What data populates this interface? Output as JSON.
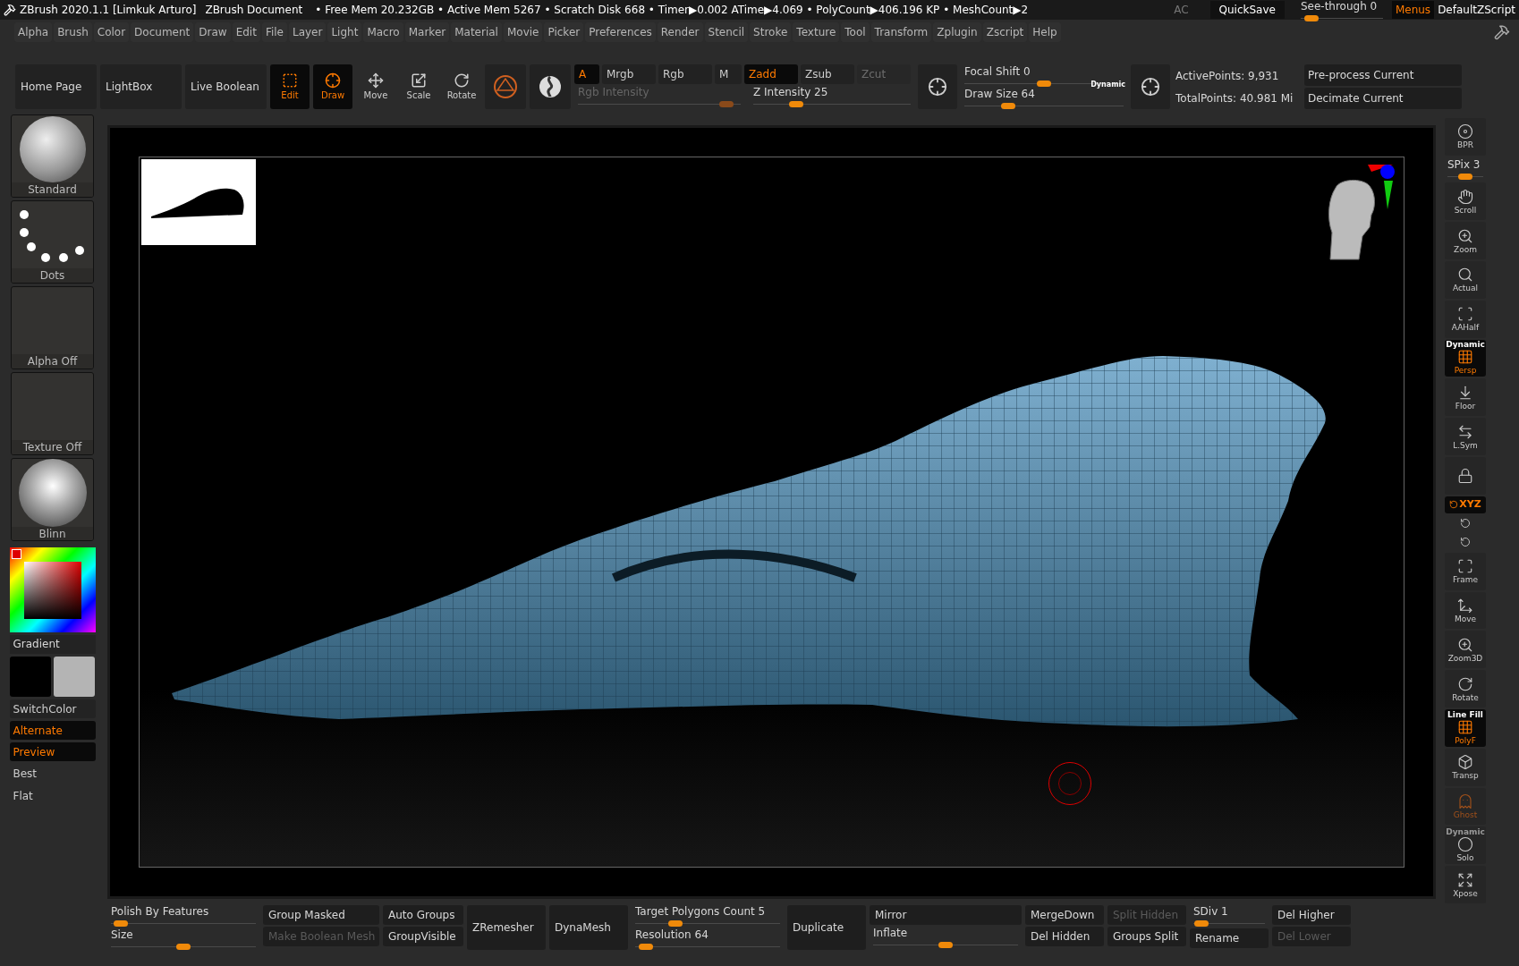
{
  "title_bar": {
    "app_title": "ZBrush 2020.1.1 [Limkuk Arturo]",
    "document": "ZBrush Document",
    "stats": "• Free Mem 20.232GB • Active Mem 5267 • Scratch Disk 668 •  Timer▶0.002 ATime▶4.069 • PolyCount▶406.196 KP  • MeshCount▶2",
    "ac": "AC",
    "quicksave": "QuickSave",
    "see_through": {
      "label": "See-through",
      "value": "0",
      "level": 0.05
    },
    "menus": {
      "label": "Menus",
      "selected": true
    },
    "script": "DefaultZScript"
  },
  "menu": [
    "Alpha",
    "Brush",
    "Color",
    "Document",
    "Draw",
    "Edit",
    "File",
    "Layer",
    "Light",
    "Macro",
    "Marker",
    "Material",
    "Movie",
    "Picker",
    "Preferences",
    "Render",
    "Stencil",
    "Stroke",
    "Texture",
    "Tool",
    "Transform",
    "Zplugin",
    "Zscript",
    "Help"
  ],
  "toolbar": {
    "pages": [
      "Home Page",
      "LightBox",
      "Live Boolean"
    ],
    "modes": [
      {
        "label": "Edit",
        "kind": "edit",
        "active": true
      },
      {
        "label": "Draw",
        "kind": "draw",
        "active": true
      },
      {
        "label": "Move",
        "kind": "move",
        "active": false
      },
      {
        "label": "Scale",
        "kind": "scale",
        "active": false
      },
      {
        "label": "Rotate",
        "kind": "rotate",
        "active": false
      }
    ],
    "channels": [
      {
        "label": "A",
        "active": true,
        "disabled": false
      },
      {
        "label": "Mrgb",
        "active": false,
        "disabled": false
      },
      {
        "label": "Rgb",
        "active": false,
        "disabled": false
      },
      {
        "label": "M",
        "active": false,
        "disabled": false
      },
      {
        "label": "Zadd",
        "active": true,
        "disabled": false
      },
      {
        "label": "Zsub",
        "active": false,
        "disabled": false
      },
      {
        "label": "Zcut",
        "active": false,
        "disabled": true
      }
    ],
    "rgb_intensity": {
      "label": "Rgb Intensity",
      "level": 0.95,
      "disabled": true
    },
    "z_intensity": {
      "label": "Z Intensity",
      "value": "25",
      "level": 0.25,
      "disabled": false
    },
    "focal_shift": {
      "label": "Focal Shift",
      "value": "0",
      "level": 0.5,
      "disabled": false
    },
    "draw_size": {
      "label": "Draw Size",
      "value": "64",
      "level": 0.25,
      "disabled": false
    },
    "dynamic": "Dynamic",
    "active_points": "ActivePoints: 9,931",
    "total_points": "TotalPoints: 40.981 Mi",
    "actions": [
      "Pre-process Current",
      "Decimate Current"
    ]
  },
  "left_shelf": {
    "tiles": [
      {
        "label": "Standard",
        "kind": "brush"
      },
      {
        "label": "Dots",
        "kind": "stroke"
      },
      {
        "label": "Alpha Off",
        "kind": "empty"
      },
      {
        "label": "Texture Off",
        "kind": "empty"
      },
      {
        "label": "Blinn",
        "kind": "material"
      }
    ],
    "gradient": "Gradient",
    "buttons": [
      {
        "label": "SwitchColor",
        "active": false
      },
      {
        "label": "Alternate",
        "active": true
      },
      {
        "label": "Preview",
        "active": true
      }
    ],
    "render_modes": [
      "Best",
      "Flat"
    ]
  },
  "right_shelf": [
    {
      "kind": "bpr",
      "label": "BPR",
      "active": false
    },
    {
      "kind": "spix",
      "label": "SPix",
      "value": "3",
      "level": 0.5
    },
    {
      "kind": "scroll",
      "label": "Scroll",
      "active": false
    },
    {
      "kind": "zoom",
      "label": "Zoom",
      "active": false
    },
    {
      "kind": "actual",
      "label": "Actual",
      "active": false
    },
    {
      "kind": "aahalf",
      "label": "AAHalf",
      "active": false
    },
    {
      "kind": "persp",
      "label": "Persp",
      "caption": "Dynamic",
      "active": true
    },
    {
      "kind": "floor",
      "label": "Floor",
      "active": false
    },
    {
      "kind": "lsym",
      "label": "L.Sym",
      "active": false
    },
    {
      "kind": "lock",
      "active": false
    },
    {
      "kind": "xyz",
      "label": "XYZ",
      "active": true
    },
    {
      "kind": "roty",
      "active": false
    },
    {
      "kind": "rotz",
      "active": false
    },
    {
      "kind": "frame",
      "label": "Frame",
      "active": false
    },
    {
      "kind": "move",
      "label": "Move",
      "active": false
    },
    {
      "kind": "zoom3d",
      "label": "Zoom3D",
      "active": false
    },
    {
      "kind": "rotate",
      "label": "Rotate",
      "active": false
    },
    {
      "kind": "polyf",
      "label": "PolyF",
      "caption": "Line Fill",
      "active": true
    },
    {
      "kind": "transp",
      "label": "Transp",
      "active": false
    },
    {
      "kind": "ghost",
      "label": "Ghost",
      "active": false
    },
    {
      "kind": "solo",
      "label": "Solo",
      "caption": "Dynamic",
      "active": false
    },
    {
      "kind": "xpose",
      "label": "Xpose",
      "active": false
    }
  ],
  "bottom_bar": [
    [
      {
        "kind": "slider",
        "label": "Polish By Features",
        "level": 0.02
      },
      {
        "kind": "slider",
        "label": "Size",
        "level": 0.5
      }
    ],
    [
      {
        "kind": "button",
        "label": "Group Masked",
        "disabled": false
      },
      {
        "kind": "button",
        "label": "Make Boolean Mesh",
        "disabled": true
      }
    ],
    [
      {
        "kind": "button",
        "label": "Auto Groups",
        "disabled": false
      },
      {
        "kind": "button",
        "label": "GroupVisible",
        "disabled": false
      }
    ],
    [
      {
        "kind": "button",
        "label": "ZRemesher",
        "disabled": false
      }
    ],
    [
      {
        "kind": "button",
        "label": "DynaMesh",
        "disabled": false
      }
    ],
    [
      {
        "kind": "slider",
        "label": "Target Polygons Count",
        "value": "5",
        "level": 0.25
      },
      {
        "kind": "slider",
        "label": "Resolution",
        "value": "64",
        "level": 0.03
      }
    ],
    [
      {
        "kind": "button",
        "label": "Duplicate",
        "disabled": false
      }
    ],
    [
      {
        "kind": "button",
        "label": "Mirror",
        "disabled": false
      },
      {
        "kind": "slider",
        "label": "Inflate",
        "level": 0.5
      }
    ],
    [
      {
        "kind": "button",
        "label": "MergeDown",
        "disabled": false
      },
      {
        "kind": "button",
        "label": "Del Hidden",
        "disabled": false
      }
    ],
    [
      {
        "kind": "button",
        "label": "Split Hidden",
        "disabled": true
      },
      {
        "kind": "button",
        "label": "Groups Split",
        "disabled": false
      }
    ],
    [
      {
        "kind": "slider",
        "label": "SDiv",
        "value": "1",
        "level": 0.02
      },
      {
        "kind": "button",
        "label": "Rename",
        "disabled": false
      }
    ],
    [
      {
        "kind": "button",
        "label": "Del Higher",
        "disabled": false
      },
      {
        "kind": "button",
        "label": "Del Lower",
        "disabled": true
      }
    ]
  ]
}
